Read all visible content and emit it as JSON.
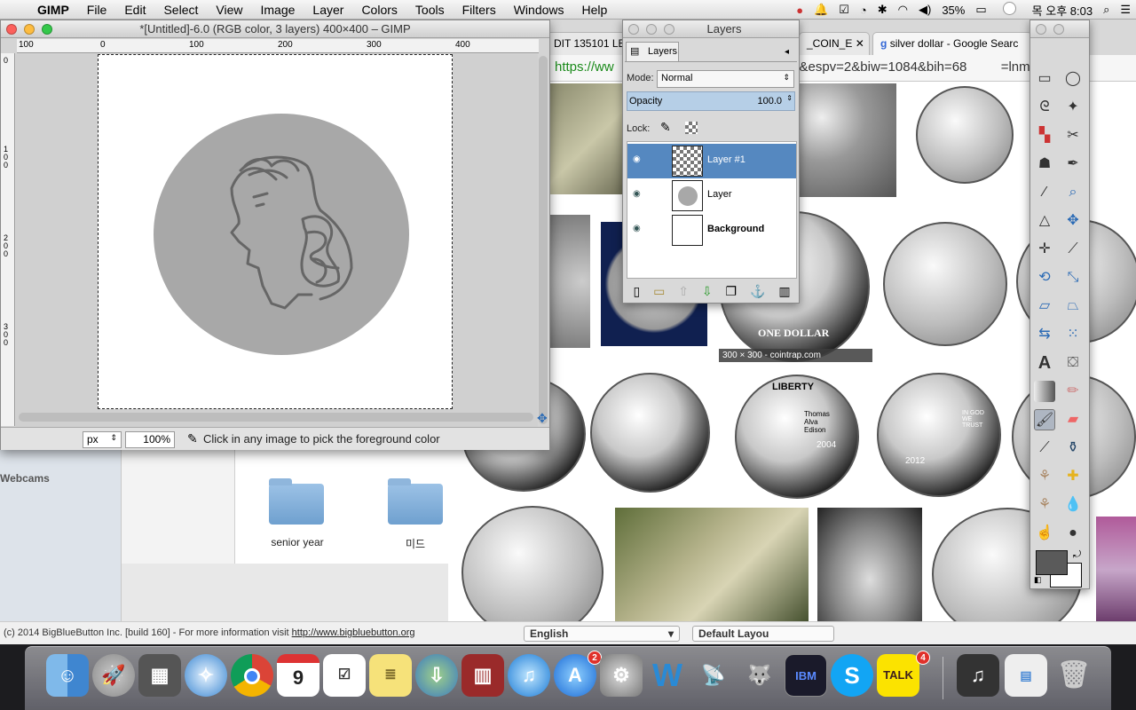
{
  "menubar": {
    "app": "GIMP",
    "items": [
      "File",
      "Edit",
      "Select",
      "View",
      "Image",
      "Layer",
      "Colors",
      "Tools",
      "Filters",
      "Windows",
      "Help"
    ],
    "battery": "35%",
    "clock": "목 오후 8:03"
  },
  "image_window": {
    "title": "*[Untitled]-6.0 (RGB color, 3 layers) 400×400 – GIMP",
    "ruler_h": [
      "100",
      "0",
      "100",
      "200",
      "300",
      "400"
    ],
    "ruler_v": [
      "0",
      "1 0 0",
      "2 0 0",
      "3 0 0"
    ],
    "unit": "px",
    "zoom": "100%",
    "status": "Click in any image to pick the foreground color"
  },
  "layers_dialog": {
    "title": "Layers",
    "tab": "Layers",
    "mode_label": "Mode:",
    "mode": "Normal",
    "opacity_label": "Opacity",
    "opacity_value": "100.0",
    "lock_label": "Lock:",
    "layers": [
      {
        "name": "Layer #1",
        "selected": true
      },
      {
        "name": "Layer",
        "selected": false
      },
      {
        "name": "Background",
        "selected": false
      }
    ]
  },
  "browser": {
    "tabs": [
      "DIT 135101 LE",
      "_COIN_E",
      "silver dollar - Google Searc"
    ],
    "url_scheme": "https://ww",
    "url_rest": "r+dollar&espv=2&biw=1084&bih=68",
    "url_tail": "=lnms&",
    "caption": "300 × 300 - cointrap.com",
    "coin_texts": [
      "ONE DOLLAR",
      "LIBERTY",
      "Thomas Alva Edison",
      "2004",
      "IN GOD WE TRUST",
      "2012",
      "IN GOD WE TRUST",
      "ONE DOLLAR"
    ]
  },
  "finder": {
    "sidebar_label": "Webcams",
    "folders": [
      "senior year",
      "미드"
    ]
  },
  "bbb": {
    "text": "(c) 2014 BigBlueButton Inc. [build 160] - For more information visit",
    "link": "http://www.bigbluebutton.org",
    "language": "English",
    "layout": "Default Layou"
  },
  "dock": {
    "calendar_day": "9",
    "appstore_badge": "2",
    "talk_badge": "4",
    "talk_label": "TALK",
    "ibm_label": "IBM"
  },
  "colors": {
    "fg": "#5a5a5a",
    "bg": "#ffffff",
    "selected_layer": "#5588c0"
  }
}
